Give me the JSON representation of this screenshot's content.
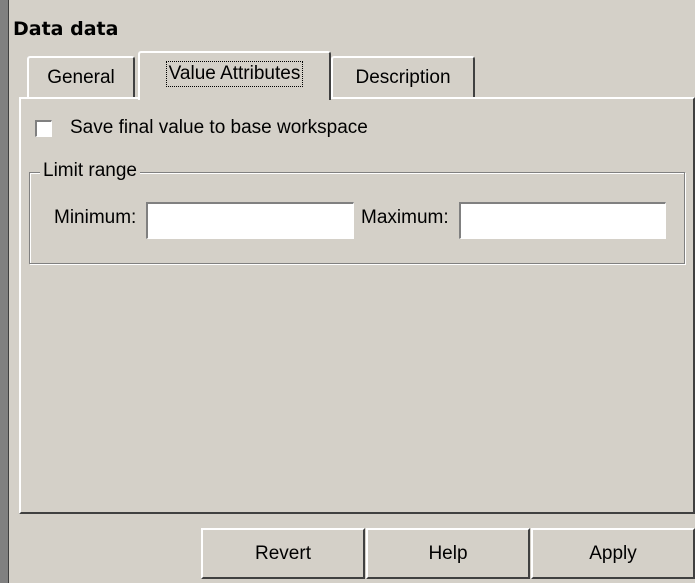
{
  "dialog": {
    "title": "Data data"
  },
  "tabs": [
    {
      "label": "General",
      "active": false
    },
    {
      "label": "Value Attributes",
      "active": true
    },
    {
      "label": "Description",
      "active": false
    }
  ],
  "value_attributes": {
    "save_checkbox": {
      "label": "Save final value to base workspace",
      "checked": false
    },
    "limit_range": {
      "legend": "Limit range",
      "minimum": {
        "label": "Minimum:",
        "value": ""
      },
      "maximum": {
        "label": "Maximum:",
        "value": ""
      }
    }
  },
  "buttons": {
    "revert": "Revert",
    "help": "Help",
    "apply": "Apply"
  }
}
